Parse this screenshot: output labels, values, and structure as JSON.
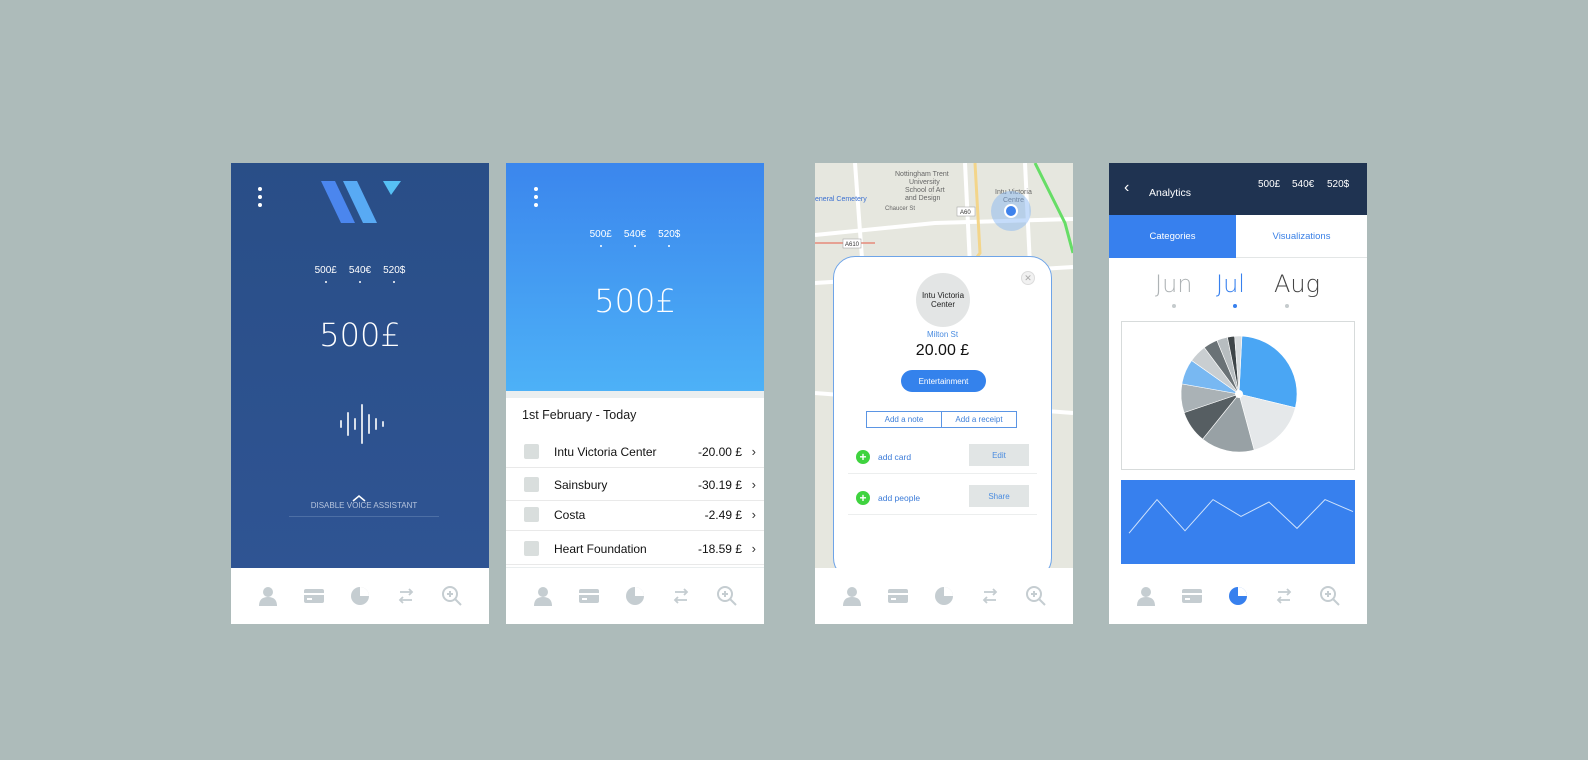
{
  "currency_options": [
    "500£",
    "540€",
    "520$"
  ],
  "voice_screen": {
    "balance": "500£",
    "disable_label": "DISABLE VOICE ASSISTANT"
  },
  "transactions_screen": {
    "balance": "500£",
    "date_range": "1st February - Today",
    "transactions": [
      {
        "name": "Intu Victoria Center",
        "amount": "-20.00 £"
      },
      {
        "name": "Sainsbury",
        "amount": "-30.19 £"
      },
      {
        "name": "Costa",
        "amount": "-2.49 £"
      },
      {
        "name": "Heart Foundation",
        "amount": "-18.59 £"
      }
    ]
  },
  "map_screen": {
    "map_labels": [
      "Nottingham Trent",
      "University",
      "School of Art",
      "and Design",
      "Chaucer St",
      "A60",
      "A610",
      "Intu Victoria",
      "Centre",
      "eneral Cemetery",
      "Milton St"
    ],
    "merchant_logo": "Intu Victoria Center",
    "street": "Milton St",
    "amount": "20.00 £",
    "category": "Entertainment",
    "add_note": "Add a note",
    "add_receipt": "Add a receipt",
    "add_card": "add card",
    "edit": "Edit",
    "add_people": "add people",
    "share": "Share"
  },
  "analytics_screen": {
    "title": "Analytics",
    "tabs": [
      "Categories",
      "Visualizations"
    ],
    "months": [
      "Jun",
      "Jul",
      "Aug"
    ],
    "selected_month": "Jul"
  },
  "colors": {
    "dark_blue": "#294e87",
    "accent_blue": "#3482ec",
    "light_blue": "#4db1f7",
    "navy": "#1f3351",
    "green": "#3fd33f"
  },
  "tab_icons": [
    "user-icon",
    "card-icon",
    "pie-chart-icon",
    "transfer-icon",
    "zoom-icon"
  ],
  "chart_data": [
    {
      "type": "pie",
      "series": [
        {
          "values": [
            28,
            17,
            15,
            9,
            8,
            7,
            5,
            4,
            3,
            2,
            2
          ]
        }
      ]
    },
    {
      "type": "line",
      "x": [
        0,
        1,
        2,
        3,
        4,
        5,
        6,
        7,
        8
      ],
      "series": [
        {
          "values": [
            10,
            80,
            15,
            80,
            45,
            75,
            20,
            80,
            55
          ]
        }
      ]
    }
  ]
}
